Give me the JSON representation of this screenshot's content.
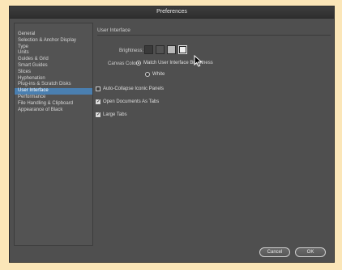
{
  "window": {
    "title": "Preferences"
  },
  "sidebar": {
    "items": [
      {
        "label": "General"
      },
      {
        "label": "Selection & Anchor Display"
      },
      {
        "label": "Type"
      },
      {
        "label": "Units"
      },
      {
        "label": "Guides & Grid"
      },
      {
        "label": "Smart Guides"
      },
      {
        "label": "Slices"
      },
      {
        "label": "Hyphenation"
      },
      {
        "label": "Plug-ins & Scratch Disks"
      },
      {
        "label": "User Interface",
        "selected": true
      },
      {
        "label": "Performance"
      },
      {
        "label": "File Handling & Clipboard"
      },
      {
        "label": "Appearance of Black"
      }
    ]
  },
  "panel": {
    "title": "User Interface",
    "brightness_label": "Brightness:",
    "brightness_swatches": [
      {
        "color": "#3a3a3a"
      },
      {
        "color": "#535353"
      },
      {
        "color": "#b8b8b8"
      },
      {
        "color": "#eeeeee",
        "selected": true
      }
    ],
    "canvas_color_label": "Canvas Color:",
    "canvas_options": [
      {
        "label": "Match User Interface Brightness",
        "checked": true
      },
      {
        "label": "White",
        "checked": false
      }
    ],
    "checkboxes": [
      {
        "label": "Auto-Collapse Iconic Panels",
        "checked": false
      },
      {
        "label": "Open Documents As Tabs",
        "checked": true
      },
      {
        "label": "Large Tabs",
        "checked": true
      }
    ]
  },
  "buttons": {
    "cancel": "Cancel",
    "ok": "OK"
  }
}
